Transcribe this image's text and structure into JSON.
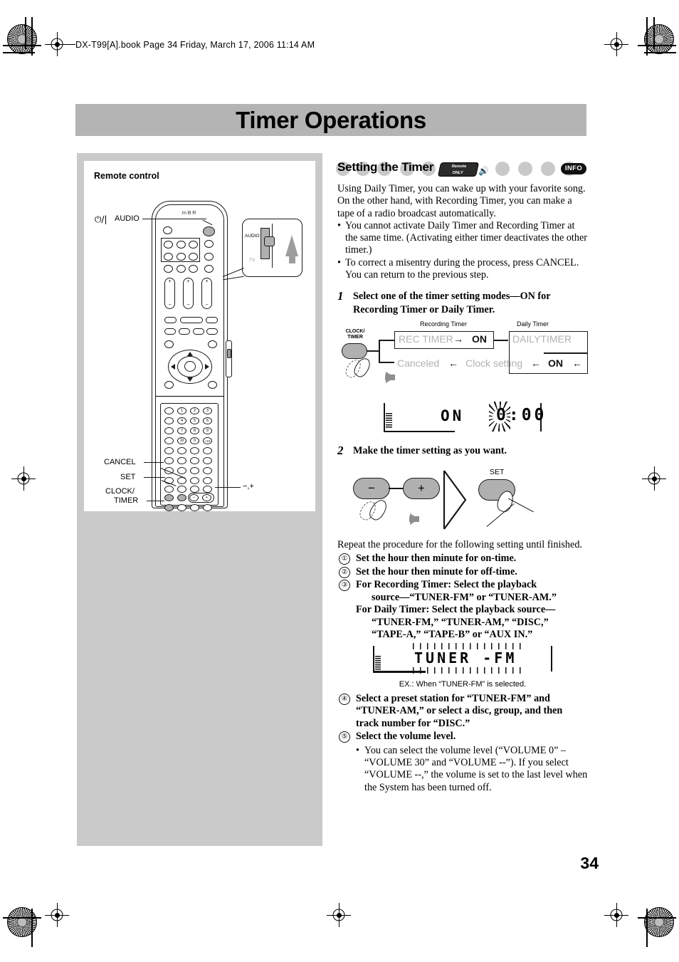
{
  "header": {
    "file_line": "DX-T99[A].book  Page 34  Friday, March 17, 2006  11:14 AM"
  },
  "page_title": "Timer Operations",
  "page_number": "34",
  "left_panel": {
    "caption": "Remote control",
    "brand": "mBR",
    "callouts": {
      "power_audio": "AUDIO",
      "power_symbol": "⏻/|",
      "cancel": "CANCEL",
      "set": "SET",
      "clock_timer_line1": "CLOCK/",
      "clock_timer_line2": "TIMER",
      "minus_plus": "−,+"
    },
    "switch_callout": {
      "audio": "AUDIO",
      "tv": "TV"
    },
    "number_keys": [
      "1",
      "2",
      "3",
      "4",
      "5",
      "6",
      "7",
      "8",
      "9",
      "10",
      "0",
      "-10"
    ]
  },
  "section": {
    "title": "Setting the Timer",
    "remote_only_badge_line1": "Remote",
    "remote_only_badge_line2": "ONLY",
    "info_badge": "INFO",
    "intro": "Using Daily Timer, you can wake up with your favorite song. On the other hand, with Recording Timer, you can make a tape of a radio broadcast automatically.",
    "intro_bullets": [
      "You cannot activate Daily Timer and Recording Timer at the same time. (Activating either timer deactivates the other timer.)",
      "To correct a misentry during the process, press CANCEL. You can return to the previous step."
    ]
  },
  "steps": [
    {
      "num": "1",
      "text": "Select one of the timer setting modes—ON for Recording Timer or Daily Timer."
    },
    {
      "num": "2",
      "text": "Make the timer setting as you want."
    }
  ],
  "diagram1": {
    "knob_label_line1": "CLOCK/",
    "knob_label_line2": "TIMER",
    "caption_recording": "Recording Timer",
    "caption_daily": "Daily Timer",
    "rec_timer": "REC TIMER",
    "rec_on": "ON",
    "dailytimer": "DAILYTIMER",
    "daily_on": "ON",
    "canceled": "Canceled",
    "clock_setting": "Clock setting",
    "arrow_right": "→",
    "arrow_left": "←"
  },
  "lcd1": {
    "mode": "ON",
    "time": "0:00"
  },
  "diagram2": {
    "minus": "−",
    "plus": "+",
    "set_label": "SET"
  },
  "repeat_text": "Repeat the procedure for the following setting until finished.",
  "substeps": [
    {
      "num": "①",
      "text": "Set the hour then minute for on-time."
    },
    {
      "num": "②",
      "text": "Set the hour then minute for off-time."
    },
    {
      "num": "③",
      "text": "For Recording Timer: Select the playback",
      "cont1": "source—“TUNER-FM” or “TUNER-AM.”",
      "cont2": "For Daily Timer: Select the playback source—",
      "cont3": "“TUNER-FM,” “TUNER-AM,” “DISC,”",
      "cont4": "“TAPE-A,” “TAPE-B” or “AUX IN.”"
    },
    {
      "num": "④",
      "text": "Select a preset station for “TUNER-FM” and “TUNER-AM,” or select a disc, group, and then track number for “DISC.”"
    },
    {
      "num": "⑤",
      "text": "Select the volume level.",
      "bullet": "You can select the volume level (“VOLUME 0” – “VOLUME 30” and “VOLUME --”). If you select “VOLUME --,” the volume is set to the last level when the System has been turned off."
    }
  ],
  "lcd2": {
    "text": "TUNER -FM",
    "caption": "EX.: When “TUNER-FM” is selected."
  },
  "colors": {
    "band": "#b4b4b4",
    "panel": "#cacaca",
    "gray_text": "#b2b2b2"
  }
}
